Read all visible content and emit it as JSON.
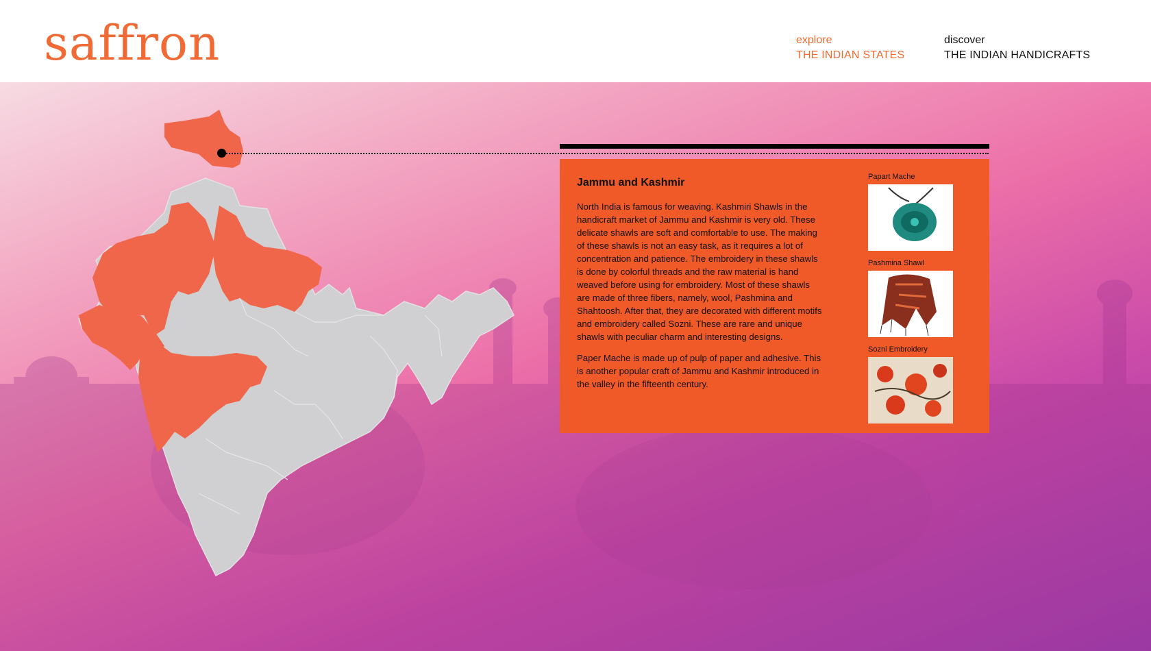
{
  "brand": {
    "logo": "saffron"
  },
  "nav": {
    "states": {
      "small": "explore",
      "big": "THE INDIAN STATES"
    },
    "crafts": {
      "small": "discover",
      "big": "THE INDIAN HANDICRAFTS"
    }
  },
  "colors": {
    "accent": "#f05a28",
    "highlight_state": "#f0664a",
    "default_state": "#d0cfd1"
  },
  "map": {
    "selected_state": "Jammu and Kashmir",
    "highlighted_states": [
      "Jammu and Kashmir",
      "Rajasthan",
      "Uttar Pradesh",
      "Gujarat",
      "Maharashtra"
    ]
  },
  "panel": {
    "title": "Jammu and Kashmir",
    "paragraphs": [
      "North India is famous for weaving. Kashmiri Shawls in the handicraft market of Jammu and Kashmir is very old. These delicate shawls are soft and comfortable to use. The making of these shawls is not an easy task, as it requires a lot of concentration and patience. The embroidery in these shawls is done by colorful threads and the raw material is hand weaved before using for embroidery. Most of these shawls are made of three fibers, namely, wool, Pashmina and Shahtoosh. After that, they are decorated with different motifs and embroidery called Sozni. These are rare and unique shawls with peculiar charm and interesting designs.",
      "Paper Mache is made up of pulp of paper and adhesive. This is another popular craft of Jammu and Kashmir introduced in the valley in the fifteenth century."
    ],
    "crafts": [
      {
        "label": "Papart Mache",
        "icon": "paper-mache-pendant-image"
      },
      {
        "label": "Pashmina Shawl",
        "icon": "pashmina-shawl-image"
      },
      {
        "label": "Sozni Embroidery",
        "icon": "sozni-embroidery-image"
      }
    ]
  }
}
